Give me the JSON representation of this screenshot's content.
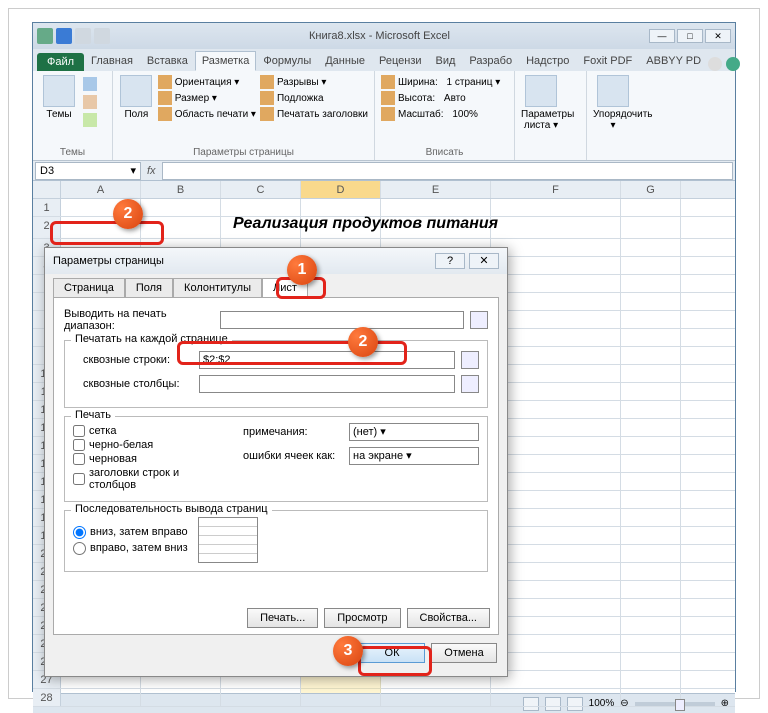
{
  "window": {
    "title": "Книга8.xlsx - Microsoft Excel"
  },
  "ribbon": {
    "file": "Файл",
    "tabs": [
      "Главная",
      "Вставка",
      "Разметка",
      "Формулы",
      "Данные",
      "Рецензи",
      "Вид",
      "Разрабо",
      "Надстро",
      "Foxit PDF",
      "ABBYY PD"
    ],
    "active_tab": "Разметка",
    "themes_big": "Темы",
    "group_themes": "Темы",
    "margins_big": "Поля",
    "orient": "Ориентация ▾",
    "size": "Размер ▾",
    "print_area": "Область печати ▾",
    "breaks": "Разрывы ▾",
    "background": "Подложка",
    "print_titles": "Печатать заголовки",
    "group_page": "Параметры страницы",
    "width_lbl": "Ширина:",
    "width_val": "1 страниц ▾",
    "height_lbl": "Высота:",
    "height_val": "Авто",
    "scale_lbl": "Масштаб:",
    "scale_val": "100%",
    "group_fit": "Вписать",
    "sheet_opts": "Параметры листа ▾",
    "arrange": "Упорядочить ▾"
  },
  "namebox": "D3",
  "columns": [
    "A",
    "B",
    "C",
    "D",
    "E",
    "F",
    "G"
  ],
  "rownums": [
    "1",
    "2"
  ],
  "sheet_title": "Реализация продуктов питания",
  "dialog": {
    "title": "Параметры страницы",
    "tabs": [
      "Страница",
      "Поля",
      "Колонтитулы",
      "Лист"
    ],
    "print_range_lbl": "Выводить на печать диапазон:",
    "repeat_group": "Печатать на каждой странице",
    "rows_lbl": "сквозные строки:",
    "rows_val": "$2:$2",
    "cols_lbl": "сквозные столбцы:",
    "print_group": "Печать",
    "grid": "сетка",
    "bw": "черно-белая",
    "draft": "черновая",
    "headings": "заголовки строк и столбцов",
    "comments_lbl": "примечания:",
    "comments_val": "(нет)",
    "errors_lbl": "ошибки ячеек как:",
    "errors_val": "на экране",
    "order_group": "Последовательность вывода страниц",
    "down_over": "вниз, затем вправо",
    "over_down": "вправо, затем вниз",
    "print_btn": "Печать...",
    "preview_btn": "Просмотр",
    "props_btn": "Свойства...",
    "ok": "ОК",
    "cancel": "Отмена"
  },
  "status": {
    "zoom": "100%"
  },
  "callouts": {
    "c1": "1",
    "c2a": "2",
    "c2b": "2",
    "c3": "3"
  }
}
